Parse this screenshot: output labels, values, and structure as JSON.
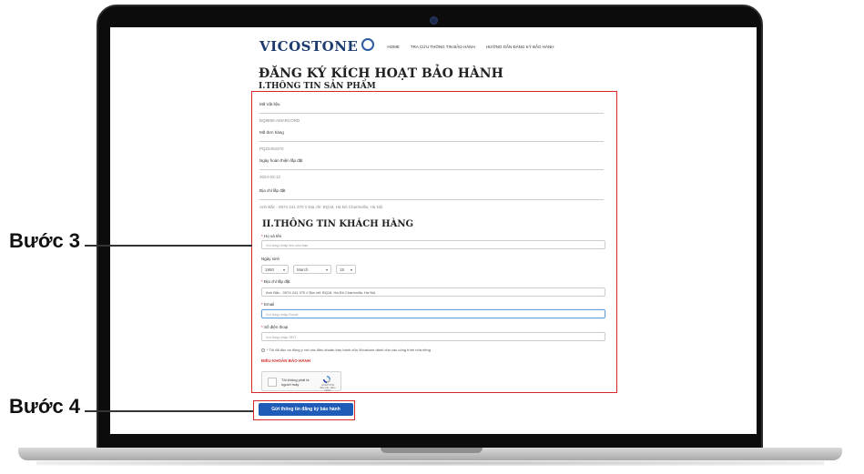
{
  "header": {
    "logo": "VICOSTONE",
    "nav": [
      "HOME",
      "TRA CỨU THÔNG TIN BẢO HÀNH",
      "HƯỚNG DẪN ĐĂNG KÝ BẢO HÀNH"
    ]
  },
  "page": {
    "title": "ĐĂNG KÝ KÍCH HOẠT BẢO HÀNH",
    "section1_title": "I.THÔNG TIN SẢN PHẨM",
    "section2_title": "II.THÔNG TIN KHÁCH HÀNG"
  },
  "product_fields": [
    {
      "label": "Mã Vật liệu",
      "value": "BQ9590-AMARCORD"
    },
    {
      "label": "Mã đơn hàng",
      "value": "PQ22402370"
    },
    {
      "label": "Ngày hoàn thiện lắp đặt",
      "value": "2024-03-12"
    },
    {
      "label": "Địa chỉ lắp đặt",
      "value": "Anh Bắc - 0974 241 370 // Địa chỉ: BQ18, Hà Đô Charmvilla, Hà Nội"
    }
  ],
  "customer": {
    "name_label": "Họ và tên",
    "name_placeholder": "Vui lòng nhập tên của bạn",
    "dob_label": "Ngày sinh",
    "dob_year": "1950",
    "dob_month": "March",
    "dob_day": "15",
    "address_label": "Địa chỉ lắp đặt",
    "address_value": "Anh Bắc - 0974 241 370 // Địa chỉ: BQ18, Hà Đô Charmvilla, Hà Nội",
    "email_label": "Email",
    "email_placeholder": "Vui lòng nhập Email",
    "phone_label": "Số điện thoại",
    "phone_placeholder": "Vui lòng nhập SĐT",
    "agree_text": "* Tôi đã đọc và đồng ý với các điều khoản bảo hành của Vicostone dành cho các công trình nhà riêng",
    "terms_link": "ĐIỀU KHOẢN BẢO HÀNH",
    "captcha_text": "Tôi không phải là người máy",
    "captcha_brand": "reCAPTCHA",
    "captcha_terms": "Bảo mật - Điều khoản"
  },
  "submit_label": "Gửi thông tin đăng ký bảo hành",
  "annotations": {
    "step3": "Bước 3",
    "step4": "Bước 4",
    "color": "#d62828"
  },
  "colors": {
    "brand": "#1d3b6f",
    "button": "#1e5cb8",
    "terms": "#d32f2f"
  }
}
